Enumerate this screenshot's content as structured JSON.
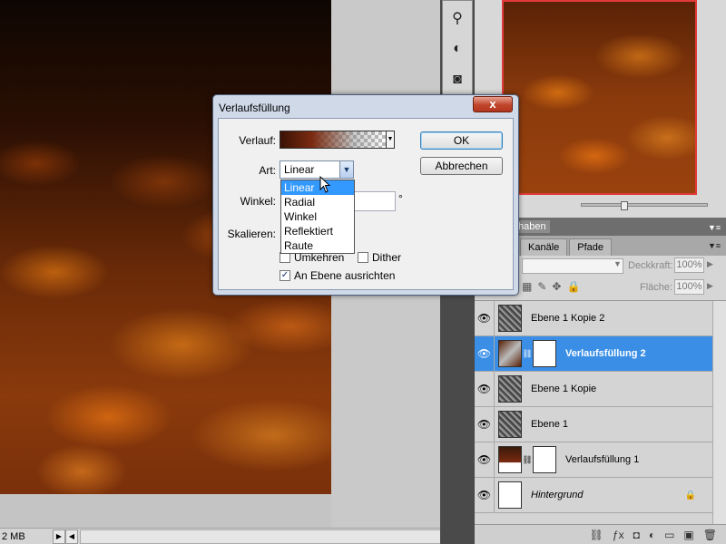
{
  "canvas": {
    "status_text": "2 MB"
  },
  "dialog": {
    "title": "Verlaufsfüllung",
    "close_label": "x",
    "verlauf_label": "Verlauf:",
    "art_label": "Art:",
    "art_value": "Linear",
    "winkel_label": "Winkel:",
    "degree": "°",
    "skalieren_label": "Skalieren:",
    "umkehren_label": "Umkehren",
    "dither_label": "Dither",
    "ausrichten_label": "An Ebene ausrichten",
    "ok_label": "OK",
    "cancel_label": "Abbrechen",
    "dropdown_options": [
      "Linear",
      "Radial",
      "Winkel",
      "Reflektiert",
      "Raute"
    ],
    "checked": {
      "umkehren": false,
      "dither": false,
      "ausrichten": true
    }
  },
  "panel": {
    "header_label": "haben",
    "tabs": [
      "Kanäle",
      "Pfade"
    ],
    "opacity_label": "Deckkraft:",
    "opacity_value": "100%",
    "fill_label": "Fläche:",
    "fill_value": "100%"
  },
  "layers": [
    {
      "name": "Ebene 1 Kopie 2"
    },
    {
      "name": "Verlaufsfüllung 2"
    },
    {
      "name": "Ebene 1 Kopie"
    },
    {
      "name": "Ebene 1"
    },
    {
      "name": "Verlaufsfüllung 1"
    },
    {
      "name": "Hintergrund"
    }
  ],
  "colors": {
    "selection": "#3a8ee6",
    "dialog_frame": "#cfd9e8",
    "close_button": "#c0452b",
    "nav_frame": "#e23a3a"
  }
}
